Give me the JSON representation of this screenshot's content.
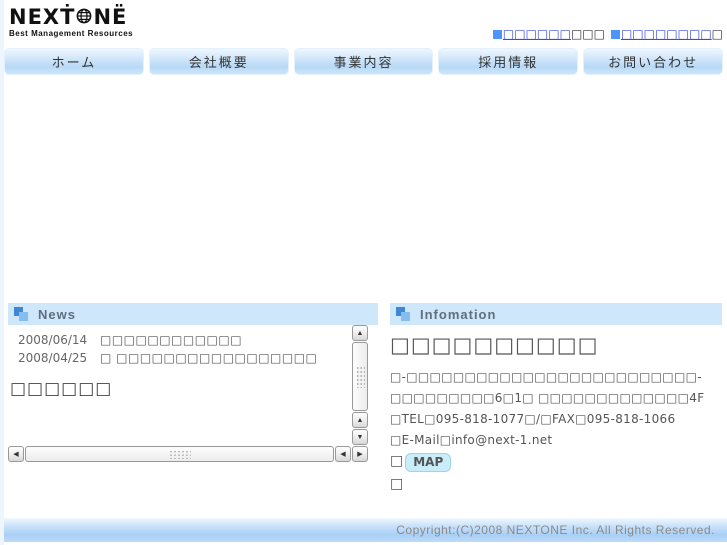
{
  "colors": {
    "accent_bar": "#cee7fa",
    "nav_gradient_mid": "#b7d9f6",
    "link_blue": "#3b4bdb",
    "bullet_blue": "#4d94ff",
    "footer_mid": "#a9cff6"
  },
  "header": {
    "logo": {
      "main": "NEXṪ",
      "suffix": "NË",
      "tagline": "Best Management Resources"
    },
    "links": [
      {
        "link_text": "□□□□□□",
        "suffix": "□□□"
      },
      {
        "link_text": "□□□□□□□□",
        "suffix": "□"
      }
    ]
  },
  "nav": {
    "items": [
      "ホーム",
      "会社概要",
      "事業内容",
      "採用情報",
      "お問い合わせ"
    ]
  },
  "news": {
    "title": "News",
    "items": [
      {
        "date": "2008/06/14",
        "text": "□□□□□□□□□□□□"
      },
      {
        "date": "2008/04/25",
        "text": "□ □□□□□□□□□□□□□□□□□"
      }
    ],
    "subheading": "□□□□□□"
  },
  "info": {
    "title": "Infomation",
    "heading": "□□□□□□□□□□",
    "lines": [
      "□-□□□□□□□□□□□□□□□□□□□□□□□□□-",
      "□□□□□□□□□6□1□ □□□□□□□□□□□□□4F",
      "□TEL□095-818-1077□/□FAX□095-818-1066",
      "□E-Mail□info@next-1.net"
    ],
    "map_prefix": "□",
    "map_label": "MAP",
    "trailing": "□"
  },
  "icons": {
    "scroll_up": "▲",
    "scroll_down": "▼",
    "scroll_left": "◀",
    "scroll_right": "▶"
  },
  "footer": {
    "copyright": "Copyright:(C)2008 NEXTONE Inc. All Rights Reserved."
  }
}
